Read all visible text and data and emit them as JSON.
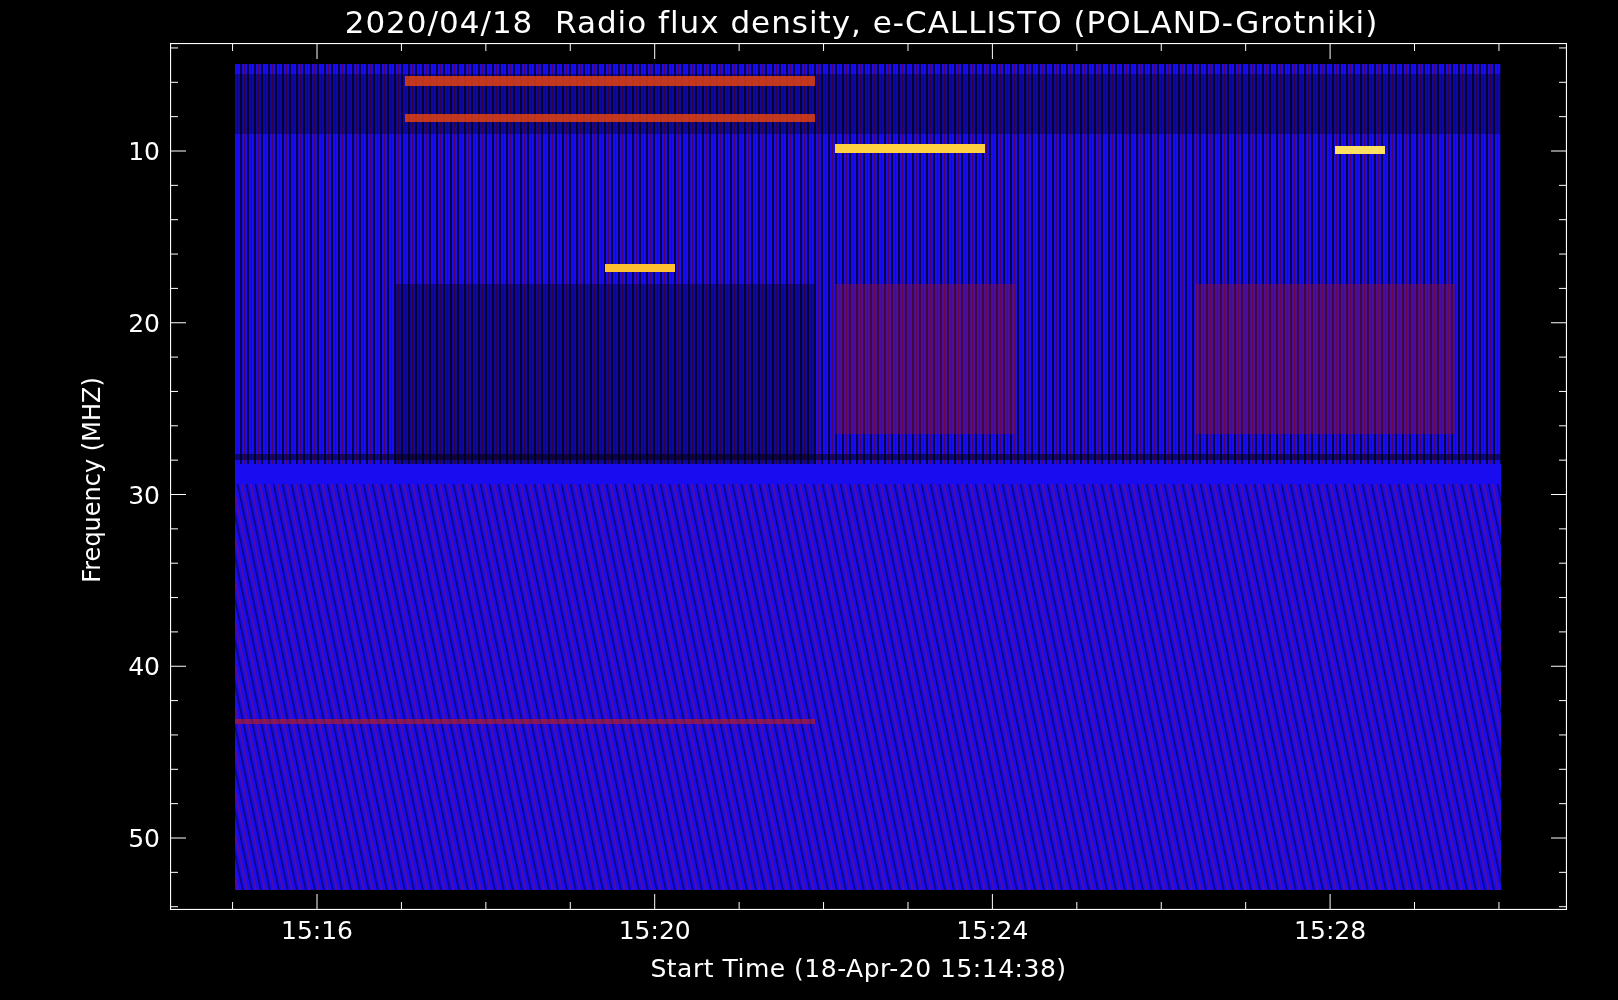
{
  "title": "2020/04/18  Radio flux density, e-CALLISTO (POLAND-Grotniki)",
  "y_axis": {
    "label": "Frequency (MHZ)",
    "ticks": [
      "10",
      "20",
      "30",
      "40",
      "50"
    ]
  },
  "x_axis": {
    "label": "Start Time (18-Apr-20 15:14:38)",
    "ticks": [
      "15:16",
      "15:20",
      "15:24",
      "15:28"
    ]
  }
}
